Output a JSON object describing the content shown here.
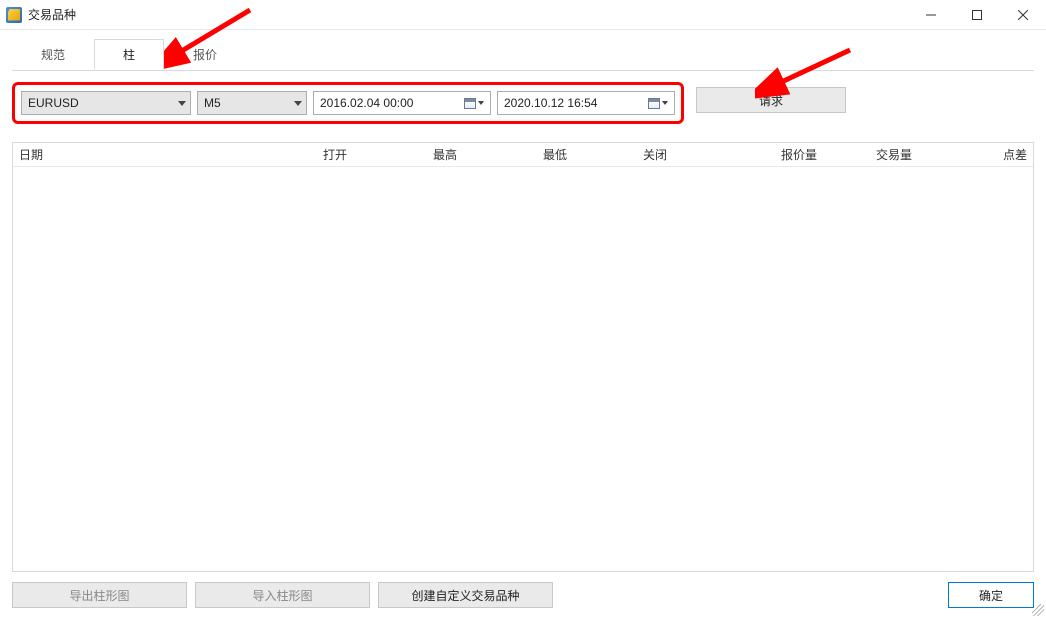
{
  "window": {
    "title": "交易品种"
  },
  "tabs": {
    "spec": "规范",
    "bars": "柱",
    "ticks": "报价"
  },
  "filter": {
    "symbol": "EURUSD",
    "timeframe": "M5",
    "from": "2016.02.04 00:00",
    "to": "2020.10.12 16:54"
  },
  "buttons": {
    "request": "请求",
    "export_bars": "导出柱形图",
    "import_bars": "导入柱形图",
    "create_custom": "创建自定义交易品种",
    "ok": "确定"
  },
  "columns": {
    "date": "日期",
    "open": "打开",
    "high": "最高",
    "low": "最低",
    "close": "关闭",
    "tick_vol": "报价量",
    "volume": "交易量",
    "spread": "点差"
  },
  "rows": []
}
